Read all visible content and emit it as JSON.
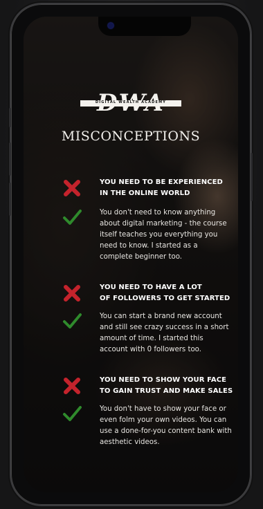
{
  "brand": {
    "logo_text": "DWA",
    "logo_subtitle": "DIGITAL WEALTH ACADEMY"
  },
  "title": "MISCONCEPTIONS",
  "colors": {
    "cross": "#c4232c",
    "check": "#2f8a2c"
  },
  "items": [
    {
      "misconception": "YOU NEED TO BE EXPERIENCED IN THE ONLINE WORLD",
      "head_lines": [
        "YOU NEED TO BE EXPERIENCED",
        "IN THE ONLINE WORLD"
      ],
      "truth": "You don't need to know anything about digital marketing - the course itself teaches you everything you need to know. I started as a complete beginner too."
    },
    {
      "misconception": "YOU NEED TO HAVE A LOT OF FOLLOWERS TO GET STARTED",
      "head_lines": [
        "YOU NEED TO HAVE A LOT",
        "OF FOLLOWERS TO GET STARTED"
      ],
      "truth": "You can start a brand new account and still see crazy success in a short amount of time. I started this account with 0 followers too."
    },
    {
      "misconception": "YOU NEED TO SHOW YOUR FACE TO GAIN TRUST AND MAKE SALES",
      "head_lines": [
        "YOU NEED TO SHOW YOUR FACE",
        "TO GAIN TRUST AND MAKE SALES"
      ],
      "truth": "You don't have to show your face or even folm your own videos. You can use a done-for-you content bank with aesthetic videos."
    }
  ]
}
